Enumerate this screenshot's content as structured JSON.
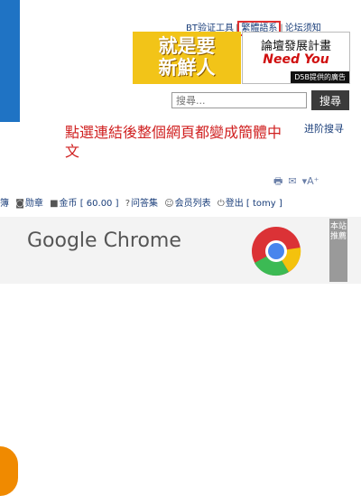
{
  "header": {
    "links": [
      "BT验证工具",
      "繁體語系",
      "论坛须知"
    ]
  },
  "ads": {
    "left_line1": "就是要",
    "left_line2": "新鮮人",
    "right_line1": "論壇發展計畫",
    "right_line2": "Need You",
    "right_badge": "D5B提供的廣告"
  },
  "search": {
    "placeholder": "搜尋...",
    "button": "搜尋",
    "advanced": "进阶搜寻"
  },
  "annotation": "點選連結後整個網頁都變成簡體中文",
  "userbar": {
    "items": [
      "簿",
      "勋章",
      "金币 [ 60.00 ]",
      "问答集",
      "会员列表",
      "登出 [ tomy ]"
    ]
  },
  "banner": {
    "title": "Google Chrome",
    "side_tab": "本站推薦"
  }
}
